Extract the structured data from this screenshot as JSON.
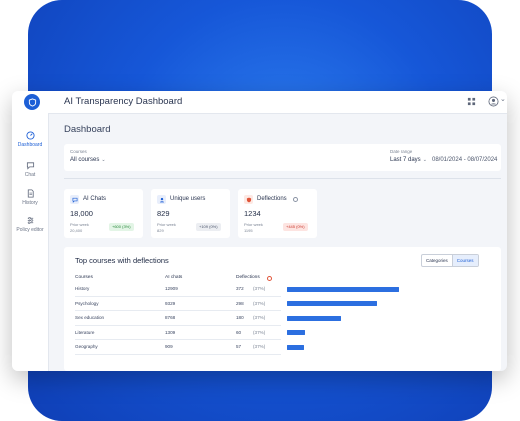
{
  "app": {
    "title": "AI Transparency Dashboard",
    "accent": "#1d5fd6"
  },
  "sidebar": {
    "items": [
      {
        "label": "Dashboard",
        "icon": "dashboard-icon",
        "active": true
      },
      {
        "label": "Chat",
        "icon": "chat-icon",
        "active": false
      },
      {
        "label": "History",
        "icon": "history-icon",
        "active": false
      },
      {
        "label": "Policy editor",
        "icon": "policy-editor-icon",
        "active": false
      }
    ]
  },
  "page": {
    "title": "Dashboard"
  },
  "filters": {
    "courses_label": "Courses",
    "courses_value": "All courses",
    "date_label": "Date range",
    "date_value": "Last 7 days",
    "date_span": "08/01/2024 - 08/07/2024"
  },
  "stats": [
    {
      "title": "AI Chats",
      "value": "18,000",
      "prior_label": "Prior week",
      "prior_value": "20,400",
      "delta": "+600 (3%)",
      "icon": "chat-icon",
      "tone": "positive"
    },
    {
      "title": "Unique users",
      "value": "829",
      "prior_label": "Prior week",
      "prior_value": "829",
      "delta": "+109 (0%)",
      "icon": "user-icon",
      "tone": "neutral"
    },
    {
      "title": "Deflections",
      "value": "1234",
      "prior_label": "Prior week",
      "prior_value": "1195",
      "delta": "+445 (0%)",
      "icon": "shield-icon",
      "tone": "negative"
    }
  ],
  "table": {
    "title": "Top courses with deflections",
    "toggle": [
      "Categories",
      "Courses"
    ],
    "toggle_active": "Courses",
    "headers": {
      "course": "Courses",
      "chats": "AI chats",
      "deflections": "Deflections"
    },
    "rows": [
      {
        "course": "History",
        "chats": "12909",
        "deflections": "372",
        "pct": "(37%)"
      },
      {
        "course": "Psychology",
        "chats": "9329",
        "deflections": "298",
        "pct": "(37%)"
      },
      {
        "course": "Sex education",
        "chats": "8768",
        "deflections": "180",
        "pct": "(37%)"
      },
      {
        "course": "Literature",
        "chats": "1309",
        "deflections": "60",
        "pct": "(37%)"
      },
      {
        "course": "Geography",
        "chats": "909",
        "deflections": "57",
        "pct": "(37%)"
      }
    ]
  }
}
